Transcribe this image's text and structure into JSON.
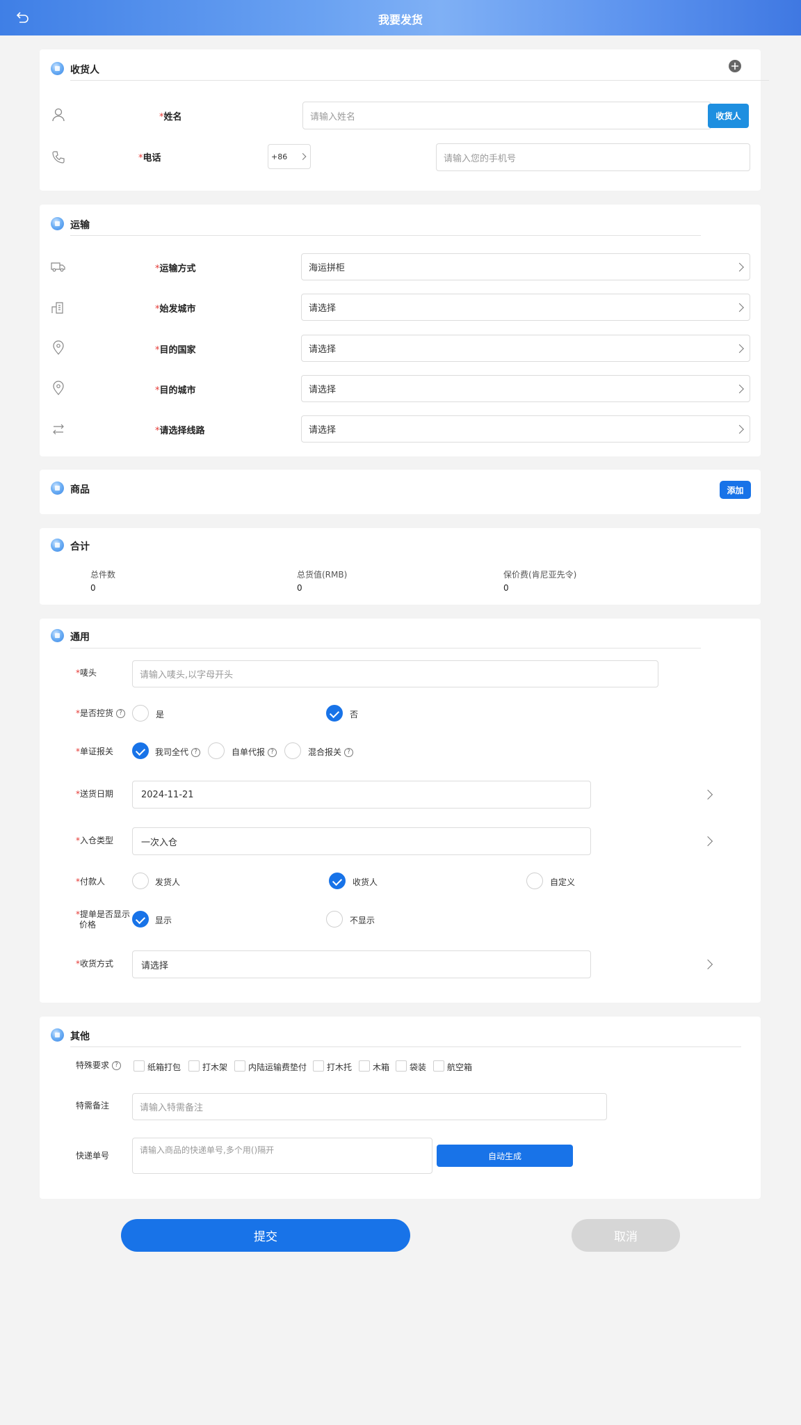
{
  "header": {
    "title": "我要发货"
  },
  "consignee": {
    "title": "收货人",
    "name_label": "姓名",
    "name_placeholder": "请输入姓名",
    "pick_button": "收货人",
    "phone_label": "电话",
    "country_code": "+86",
    "phone_placeholder": "请输入您的手机号"
  },
  "transport": {
    "title": "运输",
    "rows": [
      {
        "label": "运输方式",
        "value": "海运拼柜"
      },
      {
        "label": "始发城市",
        "value": "请选择"
      },
      {
        "label": "目的国家",
        "value": "请选择"
      },
      {
        "label": "目的城市",
        "value": "请选择"
      },
      {
        "label": "请选择线路",
        "value": "请选择"
      }
    ]
  },
  "goods": {
    "title": "商品",
    "add_button": "添加"
  },
  "total": {
    "title": "合计",
    "items": [
      {
        "label": "总件数",
        "value": "0"
      },
      {
        "label": "总货值(RMB)",
        "value": "0"
      },
      {
        "label": "保价费(肯尼亚先令)",
        "value": "0"
      }
    ]
  },
  "general": {
    "title": "通用",
    "mark_label": "唛头",
    "mark_placeholder": "请输入唛头,以字母开头",
    "collect_label": "是否控货",
    "collect_yes": "是",
    "collect_no": "否",
    "customs_label": "单证报关",
    "customs_opt1": "我司全代",
    "customs_opt2": "自单代报",
    "customs_opt3": "混合报关",
    "delivery_date_label": "送货日期",
    "delivery_date": "2024-11-21",
    "warehouse_type_label": "入仓类型",
    "warehouse_type": "一次入仓",
    "payer_label": "付款人",
    "payer_opt1": "发货人",
    "payer_opt2": "收货人",
    "payer_opt3": "自定义",
    "show_price_label_1": "提单是否显示",
    "show_price_label_2": "价格",
    "show_price_yes": "显示",
    "show_price_no": "不显示",
    "receive_method_label": "收货方式",
    "receive_method": "请选择"
  },
  "other": {
    "title": "其他",
    "special_label": "特殊要求",
    "special_options": [
      "纸箱打包",
      "打木架",
      "内陆运输费垫付",
      "打木托",
      "木箱",
      "袋装",
      "航空箱"
    ],
    "remark_label": "特需备注",
    "remark_placeholder": "请输入特需备注",
    "tracking_label": "快递单号",
    "tracking_placeholder": "请输入商品的快递单号,多个用()隔开",
    "auto_button": "自动生成"
  },
  "actions": {
    "submit": "提交",
    "cancel": "取消"
  },
  "colors": {
    "primary": "#1873e8",
    "required": "#e53935",
    "disabled": "#d6d6d6"
  }
}
